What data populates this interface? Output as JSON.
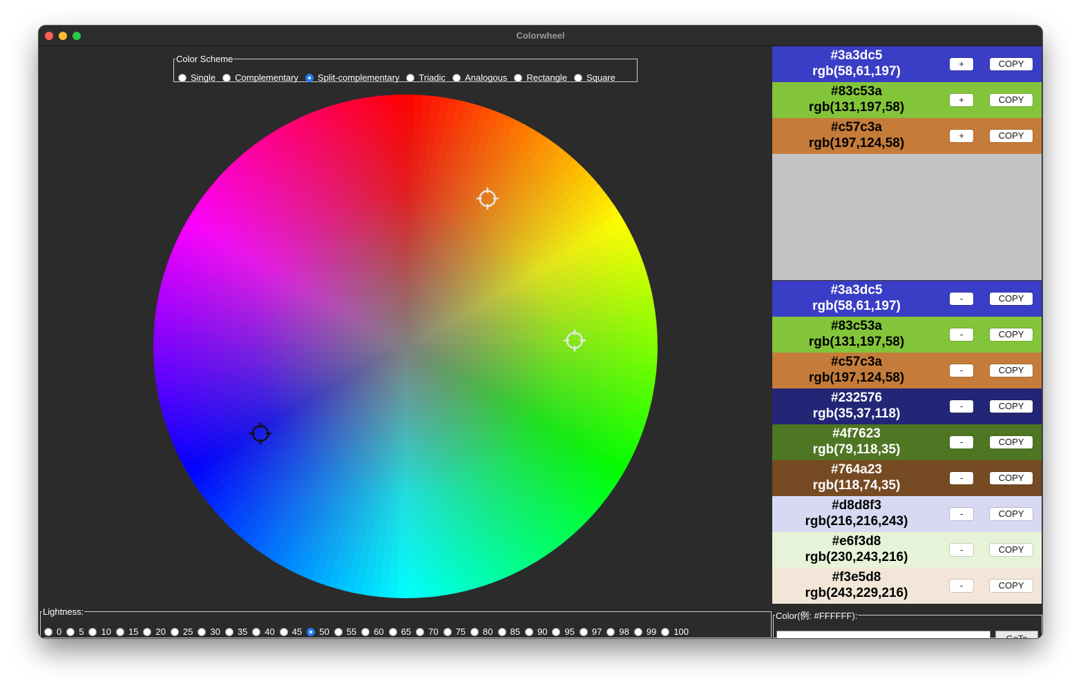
{
  "window": {
    "title": "Colorwheel"
  },
  "scheme": {
    "legend": "Color Scheme",
    "options": [
      "Single",
      "Complementary",
      "Split-complementary",
      "Triadic",
      "Analogous",
      "Rectangle",
      "Square"
    ],
    "selected": "Split-complementary"
  },
  "lightness": {
    "legend": "Lightness:",
    "options": [
      "0",
      "5",
      "10",
      "15",
      "20",
      "25",
      "30",
      "35",
      "40",
      "45",
      "50",
      "55",
      "60",
      "65",
      "70",
      "75",
      "80",
      "85",
      "90",
      "95",
      "97",
      "98",
      "99",
      "100"
    ],
    "selected": "50"
  },
  "selected_colors": [
    {
      "hex": "#3a3dc5",
      "rgb": "rgb(58,61,197)",
      "bg": "#3a3dc5",
      "text_color": "#ffffff",
      "button": "+",
      "copy": "COPY"
    },
    {
      "hex": "#83c53a",
      "rgb": "rgb(131,197,58)",
      "bg": "#83c53a",
      "text_color": "#000000",
      "button": "+",
      "copy": "COPY"
    },
    {
      "hex": "#c57c3a",
      "rgb": "rgb(197,124,58)",
      "bg": "#c57c3a",
      "text_color": "#000000",
      "button": "+",
      "copy": "COPY"
    }
  ],
  "palette": [
    {
      "hex": "#3a3dc5",
      "rgb": "rgb(58,61,197)",
      "bg": "#3a3dc5",
      "text_color": "#ffffff",
      "button": "-",
      "copy": "COPY"
    },
    {
      "hex": "#83c53a",
      "rgb": "rgb(131,197,58)",
      "bg": "#83c53a",
      "text_color": "#000000",
      "button": "-",
      "copy": "COPY"
    },
    {
      "hex": "#c57c3a",
      "rgb": "rgb(197,124,58)",
      "bg": "#c57c3a",
      "text_color": "#000000",
      "button": "-",
      "copy": "COPY"
    },
    {
      "hex": "#232576",
      "rgb": "rgb(35,37,118)",
      "bg": "#232576",
      "text_color": "#ffffff",
      "button": "-",
      "copy": "COPY"
    },
    {
      "hex": "#4f7623",
      "rgb": "rgb(79,118,35)",
      "bg": "#4f7623",
      "text_color": "#ffffff",
      "button": "-",
      "copy": "COPY"
    },
    {
      "hex": "#764a23",
      "rgb": "rgb(118,74,35)",
      "bg": "#764a23",
      "text_color": "#ffffff",
      "button": "-",
      "copy": "COPY"
    },
    {
      "hex": "#d8d8f3",
      "rgb": "rgb(216,216,243)",
      "bg": "#d8d8f3",
      "text_color": "#000000",
      "button": "-",
      "copy": "COPY"
    },
    {
      "hex": "#e6f3d8",
      "rgb": "rgb(230,243,216)",
      "bg": "#e6f3d8",
      "text_color": "#000000",
      "button": "-",
      "copy": "COPY"
    },
    {
      "hex": "#f3e5d8",
      "rgb": "rgb(243,229,216)",
      "bg": "#f3e5d8",
      "text_color": "#000000",
      "button": "-",
      "copy": "COPY"
    }
  ],
  "color_input": {
    "legend": "Color(例: #FFFFFF):",
    "value": "",
    "goto_label": "GoTo"
  },
  "wheel": {
    "markers": [
      {
        "name": "marker-blue",
        "hue_deg": 239,
        "style": "dark"
      },
      {
        "name": "marker-orange",
        "hue_deg": 29,
        "style": "light"
      },
      {
        "name": "marker-green",
        "hue_deg": 88,
        "style": "light"
      }
    ]
  }
}
